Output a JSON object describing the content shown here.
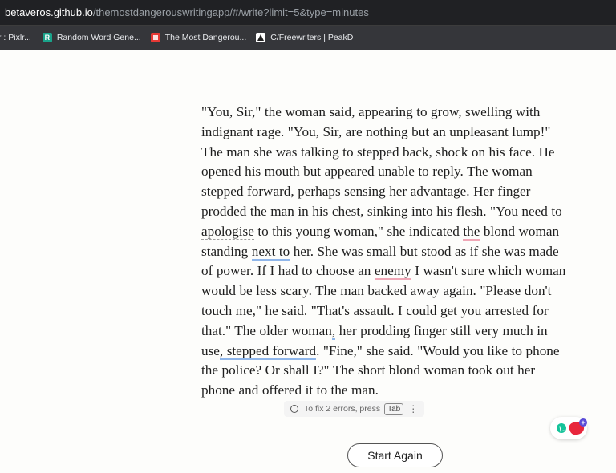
{
  "browser": {
    "url_host": "betaveros.github.io",
    "url_path": "/themostdangerouswritingapp/#/write?limit=5&type=minutes"
  },
  "bookmarks": [
    {
      "label": "r : Pixlr...",
      "icon": "none"
    },
    {
      "label": "Random Word Gene...",
      "icon": "random-word-generator-icon"
    },
    {
      "label": "The Most Dangerou...",
      "icon": "most-dangerous-app-icon"
    },
    {
      "label": "C/Freewriters | PeakD",
      "icon": "peakd-icon"
    }
  ],
  "editor": {
    "lines": [
      [
        {
          "t": "\"You, Sir,\" the woman said, appearing to grow, swelling with"
        }
      ],
      [
        {
          "t": "indignant rage. \"You, Sir, are nothing but an unpleasant lump!\""
        }
      ],
      [
        {
          "t": "The man she was talking to stepped back, shock on his face. He"
        }
      ],
      [
        {
          "t": "opened his mouth but appeared unable to reply. The woman"
        }
      ],
      [
        {
          "t": "stepped forward, perhaps sensing her advantage. Her finger"
        }
      ],
      [
        {
          "t": "prodded the man in his chest, sinking into his flesh. \"You need to"
        }
      ],
      [
        {
          "t": "apologise",
          "u": "dot"
        },
        {
          "t": " to this young woman,\" she indicated "
        },
        {
          "t": "the",
          "u": "red"
        },
        {
          "t": " blond woman"
        }
      ],
      [
        {
          "t": "standing "
        },
        {
          "t": "next to",
          "u": "blue"
        },
        {
          "t": " her. She was small but stood as if she was made"
        }
      ],
      [
        {
          "t": "of power. If I had to choose an "
        },
        {
          "t": "enemy",
          "u": "red"
        },
        {
          "t": " I wasn't sure which woman"
        }
      ],
      [
        {
          "t": "would be less scary. The man backed away again. \"Please don't"
        }
      ],
      [
        {
          "t": "touch me,\" he said. \"That's assault. I could get you arrested for"
        }
      ],
      [
        {
          "t": "that.\" The older woman"
        },
        {
          "t": ",",
          "u": "blue"
        },
        {
          "t": " her prodding finger still very much in"
        }
      ],
      [
        {
          "t": "use"
        },
        {
          "t": ", stepped forward",
          "u": "blue"
        },
        {
          "t": ". \"Fine,\" she said. \"Would you like to phone"
        }
      ],
      [
        {
          "t": "the police? Or shall I?\" The "
        },
        {
          "t": "short",
          "u": "dot"
        },
        {
          "t": " blond woman took out her"
        }
      ],
      [
        {
          "t": "phone and offered it to the man."
        }
      ]
    ]
  },
  "grammar_bar": {
    "message": "To fix 2 errors, press",
    "key": "Tab",
    "more": "⋮"
  },
  "start_button": {
    "label": "Start Again"
  },
  "colors": {
    "page_bg": "#fdfdfb",
    "text": "#1e1e1e",
    "spelling_underline": "#f0a7b6",
    "grammar_underline": "#8fb6ea"
  }
}
